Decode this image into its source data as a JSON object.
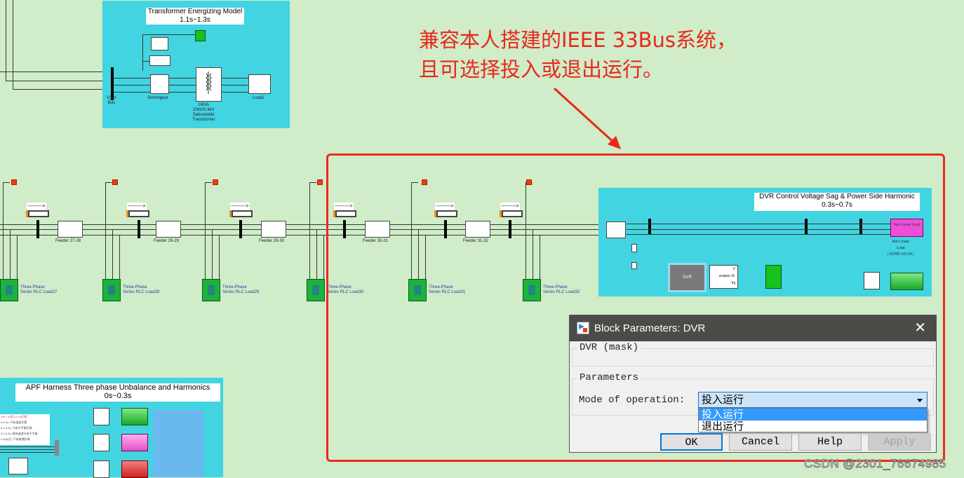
{
  "annotation": {
    "line1": "兼容本人搭建的IEEE 33Bus系统，",
    "line2": "且可选择投入或退出运行。"
  },
  "transformer_panel": {
    "title": "Transformer Energizing Model",
    "subtitle": "1.1s~1.3s",
    "bus_label_1": "10kV",
    "bus_label_2": "Bus",
    "switchgear_label": "Switchgear",
    "transformer_label_1": "1MVA",
    "transformer_label_2": "10kV/0.4kV",
    "transformer_label_3": "Saturatable",
    "transformer_label_4": "Transformer",
    "load_label": "Load2"
  },
  "feeders": [
    {
      "label": "Feeder 27-28",
      "load": "Series RLC Load27"
    },
    {
      "label": "Feeder 28-29",
      "load": "Series RLC Load28"
    },
    {
      "label": "Feeder 29-30",
      "load": "Series RLC Load29"
    },
    {
      "label": "Feeder 30-31",
      "load": "Series RLC Load30"
    },
    {
      "label": "Feeder 31-32",
      "load": "Series RLC Load31"
    },
    {
      "label": "",
      "load": "Series RLC Load32"
    }
  ],
  "load_type": "Three-Phase",
  "goto_arrow": "--------->",
  "dvr_panel": {
    "title": "DVR Control Voltage Sag & Power Side Harmonic",
    "subtitle": "0.3s~0.7s",
    "dvr_block": "DVR",
    "scope_ports": [
      "V",
      "scopes VL",
      "Inj"
    ],
    "nonlinear_block": "Non Linear Load",
    "nonlinear_label_1": "Non Linear",
    "nonlinear_label_2": "Load",
    "nonlinear_label_3": "( %THD =22.24 )"
  },
  "apf_panel": {
    "title": "APF Harness Three phase Unbalance and Harmonics",
    "subtitle": "0s~0.3s",
    "notes": [
      "APF: 0s投入0.3s切除",
      "0-0.1s: 只有谐波负载",
      "0.1-0.2s: 只有不平衡负载",
      "0.2-0.3s: 既有谐波又有不平衡",
      "0.3s以后: 只有普通负载"
    ]
  },
  "dialog": {
    "title": "Block Parameters: DVR",
    "mask_group": "DVR (mask)",
    "params_group": "Parameters",
    "mode_label": "Mode of operation:",
    "mode_value": "投入运行",
    "options": [
      "投入运行",
      "退出运行"
    ],
    "selected_index": 0,
    "buttons": {
      "ok": "OK",
      "cancel": "Cancel",
      "help": "Help",
      "apply": "Apply"
    }
  },
  "watermark": "CSDN @2301_76674985",
  "colors": {
    "canvas": "#d0ecc8",
    "panel": "#42d4e0",
    "highlight": "#ee2a1e"
  }
}
